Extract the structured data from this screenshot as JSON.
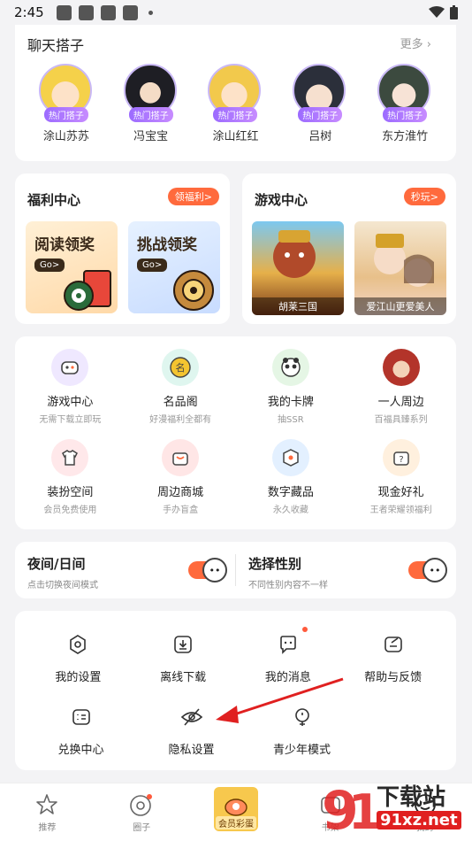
{
  "status": {
    "time": "2:45"
  },
  "chat": {
    "title": "聊天搭子",
    "more": "更多",
    "badge": "热门搭子",
    "partners": [
      {
        "name": "涂山苏苏"
      },
      {
        "name": "冯宝宝"
      },
      {
        "name": "涂山红红"
      },
      {
        "name": "吕树"
      },
      {
        "name": "东方淮竹"
      }
    ]
  },
  "welfare": {
    "title": "福利中心",
    "pill": "领福利>",
    "cards": [
      {
        "text": "阅读领奖",
        "go": "Go>"
      },
      {
        "text": "挑战领奖",
        "go": "Go>"
      }
    ]
  },
  "game": {
    "title": "游戏中心",
    "pill": "秒玩>",
    "cards": [
      {
        "caption": "胡莱三国"
      },
      {
        "caption": "爱江山更爱美人"
      }
    ]
  },
  "grid": {
    "items": [
      {
        "label": "游戏中心",
        "sub": "无需下载立即玩"
      },
      {
        "label": "名品阁",
        "sub": "好漫福利全都有"
      },
      {
        "label": "我的卡牌",
        "sub": "抽SSR"
      },
      {
        "label": "一人周边",
        "sub": "百福具臻系列"
      },
      {
        "label": "装扮空间",
        "sub": "会员免费使用"
      },
      {
        "label": "周边商城",
        "sub": "手办盲盒"
      },
      {
        "label": "数字藏品",
        "sub": "永久收藏"
      },
      {
        "label": "现金好礼",
        "sub": "王者荣耀领福利"
      }
    ]
  },
  "toggles": {
    "night": {
      "title": "夜间/日间",
      "sub": "点击切换夜间模式"
    },
    "gender": {
      "title": "选择性别",
      "sub": "不同性别内容不一样"
    }
  },
  "settings": {
    "items": [
      {
        "label": "我的设置"
      },
      {
        "label": "离线下载"
      },
      {
        "label": "我的消息"
      },
      {
        "label": "帮助与反馈"
      },
      {
        "label": "兑换中心"
      },
      {
        "label": "隐私设置"
      },
      {
        "label": "青少年模式"
      }
    ]
  },
  "tabbar": {
    "tabs": [
      {
        "label": "推荐"
      },
      {
        "label": "圈子"
      },
      {
        "label": "会员彩蛋"
      },
      {
        "label": "书架"
      },
      {
        "label": "我的"
      }
    ]
  },
  "watermark": {
    "brand": "下载站",
    "site": "91xz.net"
  },
  "colors": {
    "accent": "#ff6a3d",
    "badge": "#a77bff",
    "arrow": "#e02020"
  }
}
